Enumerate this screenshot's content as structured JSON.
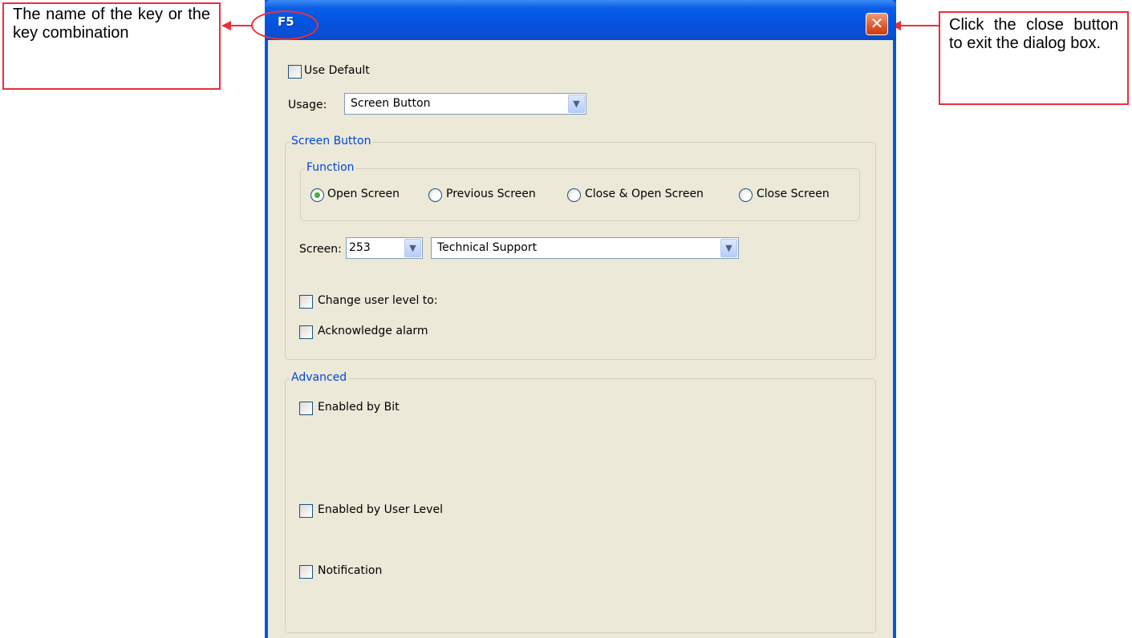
{
  "dialog": {
    "title": "F5",
    "close_glyph": "✕",
    "use_default_label": "Use Default",
    "usage_label": "Usage:",
    "usage_value": "Screen Button",
    "screen_button_group": {
      "title": "Screen Button",
      "function_group_title": "Function",
      "functions": [
        {
          "label": "Open Screen",
          "checked": true
        },
        {
          "label": "Previous Screen",
          "checked": false
        },
        {
          "label": "Close & Open Screen",
          "checked": false
        },
        {
          "label": "Close Screen",
          "checked": false
        }
      ],
      "screen_label": "Screen:",
      "screen_number": "253",
      "screen_name": "Technical Support",
      "change_user_level_label": "Change user level to:",
      "acknowledge_alarm_label": "Acknowledge alarm"
    },
    "advanced_group": {
      "title": "Advanced",
      "enabled_by_bit_label": "Enabled by Bit",
      "enabled_by_user_level_label": "Enabled by User Level",
      "notification_label": "Notification"
    }
  },
  "callouts": {
    "left": "The name of the key or the key combination",
    "right": "Click the close button to exit the dialog box."
  },
  "icons": {
    "dropdown": "chevron-down-icon",
    "close": "close-icon",
    "arrow": "arrow-left-icon"
  },
  "colors": {
    "callout_border": "#e8303a",
    "titlebar": "#0354e0",
    "dialog_face": "#ece9d8",
    "group_title": "#0046d5"
  }
}
